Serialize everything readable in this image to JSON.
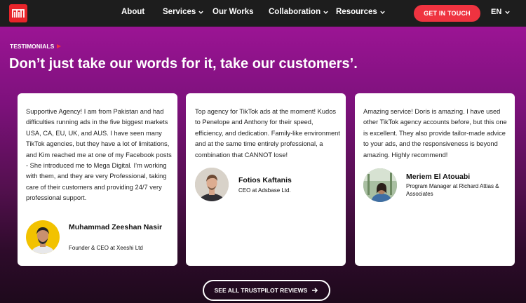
{
  "colors": {
    "accent": "#ef3340",
    "nav_bg": "#1d1d1d",
    "hero_top": "#9b1494",
    "hero_bottom": "#1e0a1c"
  },
  "nav": {
    "logo_icon": "mega-digital-logo",
    "items": [
      {
        "label": "About"
      },
      {
        "label": "Services"
      },
      {
        "label": "Our Works"
      },
      {
        "label": "Collaboration"
      },
      {
        "label": "Resources"
      }
    ],
    "cta_label": "GET IN TOUCH",
    "language": "EN"
  },
  "section": {
    "eyebrow": "TESTIMONIALS",
    "headline": "Don’t just take our words for it, take our customers’."
  },
  "testimonials": [
    {
      "quote": "Supportive Agency! I am from Pakistan and had difficulties running ads in the five biggest markets USA, CA, EU, UK, and AUS. I have seen many TikTok agencies, but they have a lot of limitations, and Kim reached me at one of my Facebook posts - She introduced me to Mega Digital. I’m working with them, and they are very Professional, taking care of their customers and providing 24/7 very professional support.",
      "name": "Muhammad Zeeshan Nasir",
      "role": "Founder & CEO at Xeeshi Ltd"
    },
    {
      "quote": "Top agency for TikTok ads at the moment! Kudos to Penelope and Anthony for their speed, efficiency, and dedication. Family-like environment and at the same time entirely professional, a combination that CANNOT lose!",
      "name": "Fotios Kaftanis",
      "role": "CEO at Adsbase Ltd."
    },
    {
      "quote": "Amazing service! Doris is amazing. I have used other TikTok agency accounts before, but this one is excellent. They also provide tailor-made advice to your ads, and the responsiveness is beyond amazing. Highly recommend!",
      "name": "Meriem El Atouabi",
      "role": "Program Manager at Richard Attias & Associates"
    }
  ],
  "see_all_label": "SEE ALL TRUSTPILOT REVIEWS"
}
